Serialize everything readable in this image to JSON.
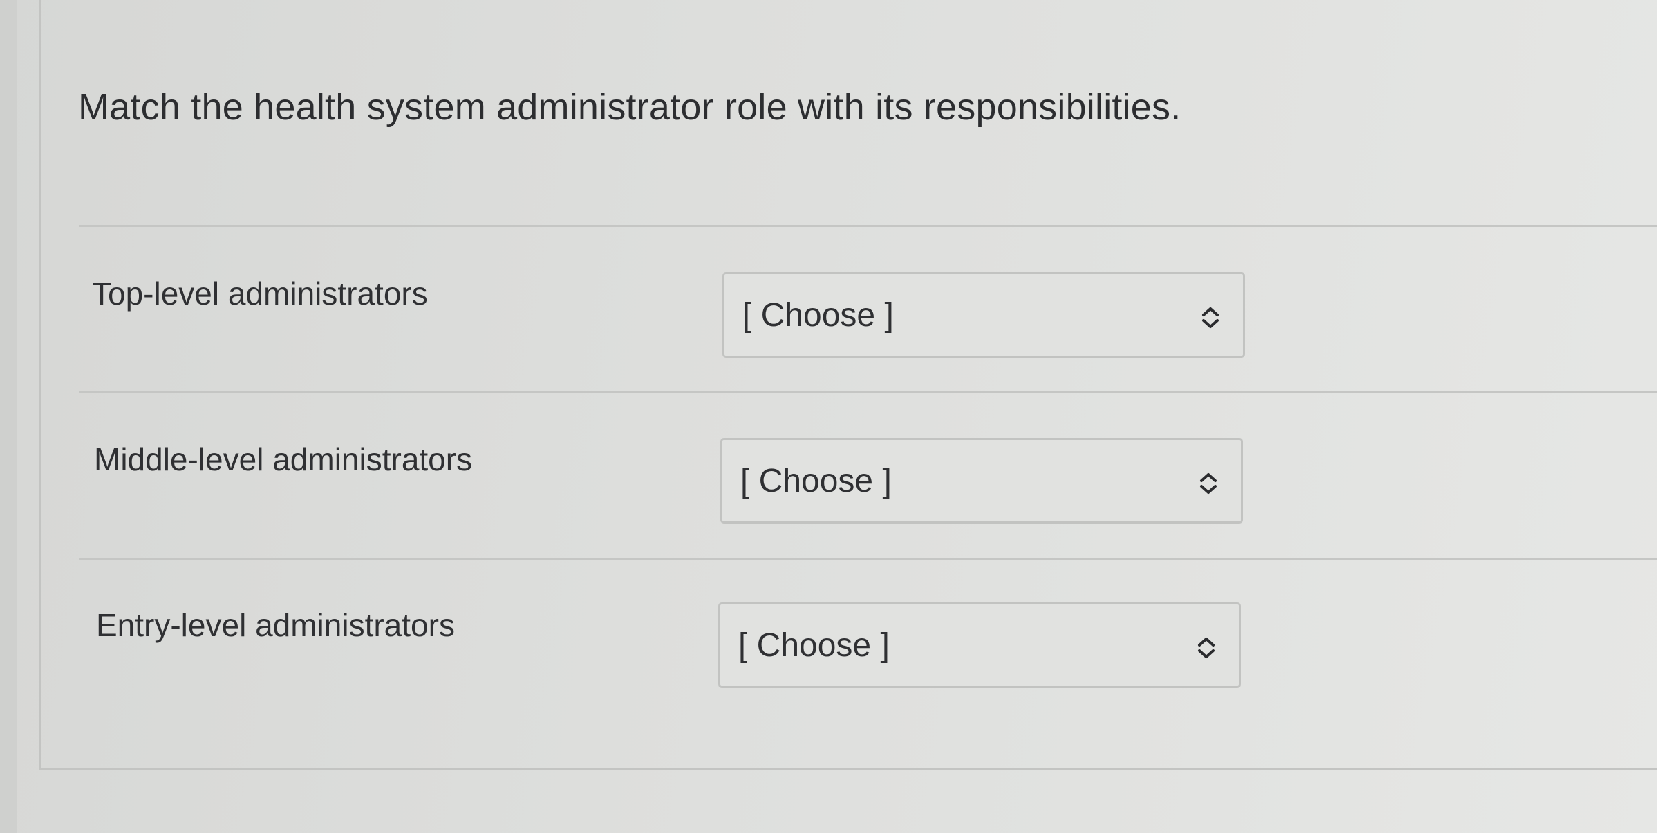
{
  "question": {
    "text": "Match the health system administrator role with its responsibilities."
  },
  "rows": [
    {
      "label": "Top-level administrators",
      "selected": "[ Choose ]"
    },
    {
      "label": "Middle-level administrators",
      "selected": "[ Choose ]"
    },
    {
      "label": "Entry-level administrators",
      "selected": "[ Choose ]"
    }
  ],
  "colors": {
    "text": "#2f3033",
    "border": "#c2c3c1",
    "background": "#dddedc"
  },
  "icons": {
    "select_arrows": "chevron-up-down-icon"
  }
}
